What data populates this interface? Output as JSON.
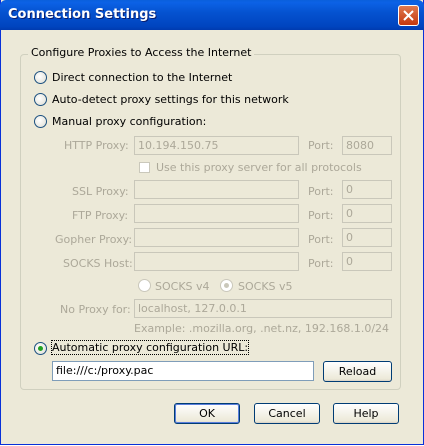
{
  "window": {
    "title": "Connection Settings"
  },
  "group_label": "Configure Proxies to Access the Internet",
  "options": {
    "direct": "Direct connection to the Internet",
    "autodetect": "Auto-detect proxy settings for this network",
    "manual": "Manual proxy configuration:",
    "auto_url": "Automatic proxy configuration URL:"
  },
  "manual": {
    "http_label": "HTTP Proxy:",
    "http_value": "10.194.150.75",
    "port_label": "Port:",
    "http_port": "8080",
    "use_same": "Use this proxy server for all protocols",
    "ssl_label": "SSL Proxy:",
    "ssl_port": "0",
    "ftp_label": "FTP Proxy:",
    "ftp_port": "0",
    "gopher_label": "Gopher Proxy:",
    "gopher_port": "0",
    "socks_label": "SOCKS Host:",
    "socks_port": "0",
    "socks_v4": "SOCKS v4",
    "socks_v5": "SOCKS v5",
    "noproxy_label": "No Proxy for:",
    "noproxy_value": "localhost, 127.0.0.1",
    "example": "Example: .mozilla.org, .net.nz, 192.168.1.0/24"
  },
  "auto": {
    "url_value": "file:///c:/proxy.pac",
    "reload": "Reload"
  },
  "buttons": {
    "ok": "OK",
    "cancel": "Cancel",
    "help": "Help"
  }
}
